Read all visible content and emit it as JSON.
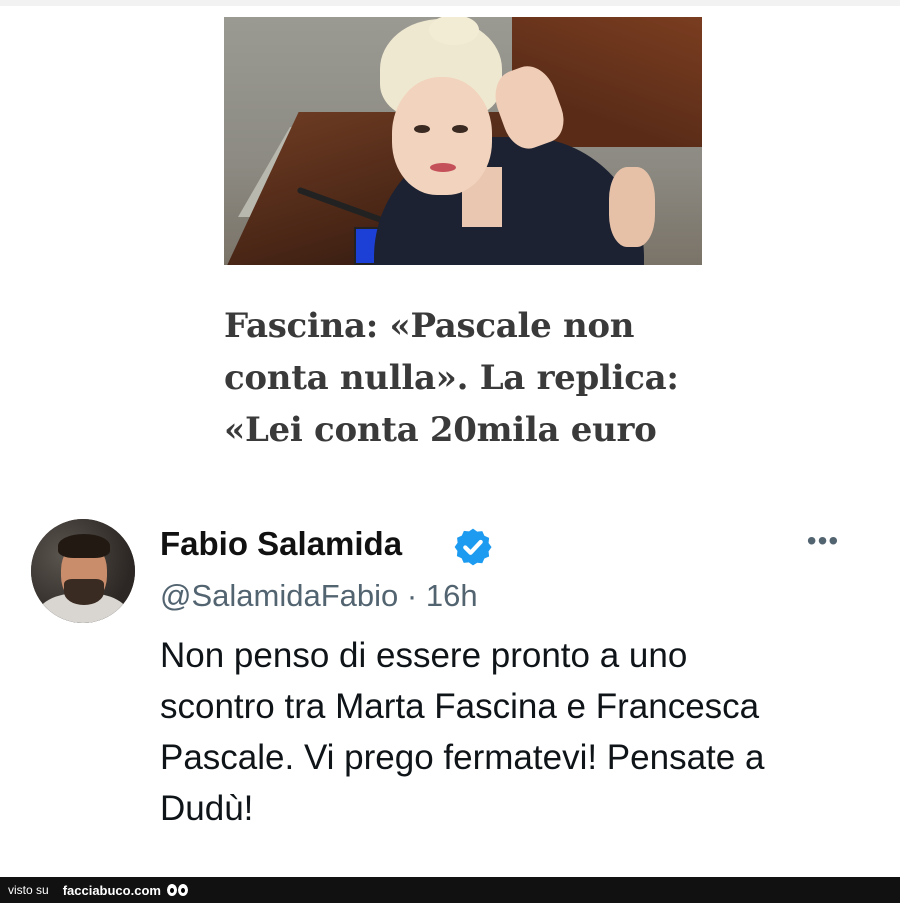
{
  "article": {
    "headline_lines": [
      "Fascina: «Pascale non",
      "conta nulla». La replica:",
      "«Lei conta 20mila euro"
    ]
  },
  "tweet": {
    "author_name": "Fabio Salamida",
    "verified": true,
    "handle": "@SalamidaFabio",
    "separator": "·",
    "time": "16h",
    "more_label": "•••",
    "text_lines": [
      "Non penso di essere pronto a uno",
      "scontro tra Marta Fascina e Francesca",
      "Pascale. Vi prego fermatevi! Pensate a",
      "Dudù!"
    ],
    "verified_color": "#1d9bf0"
  },
  "footer": {
    "prefix": "visto su",
    "site": "facciabuco.com"
  }
}
